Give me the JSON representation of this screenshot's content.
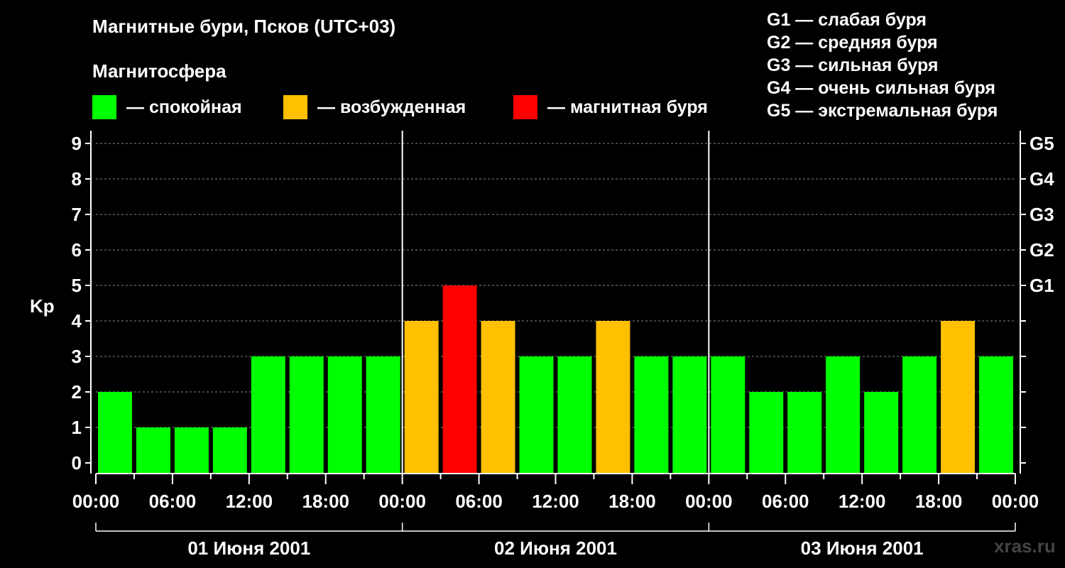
{
  "title": "Магнитные бури, Псков (UTC+03)",
  "subtitle": "Магнитосфера",
  "legend": [
    {
      "color": "#00ff00",
      "label": "— спокойная"
    },
    {
      "color": "#ffc000",
      "label": "— возбужденная"
    },
    {
      "color": "#ff0000",
      "label": "— магнитная буря"
    }
  ],
  "g_scale": [
    "G1 — слабая буря",
    "G2 — средняя буря",
    "G3 — сильная буря",
    "G4 — очень сильная буря",
    "G5 — экстремальная буря"
  ],
  "watermark": "xras.ru",
  "chart_data": {
    "type": "bar",
    "ylabel": "Kp",
    "ylim": [
      0,
      9
    ],
    "y_ticks": [
      "0",
      "1",
      "2",
      "3",
      "4",
      "5",
      "6",
      "7",
      "8",
      "9"
    ],
    "right_ticks": [
      {
        "value": 5,
        "label": "G1"
      },
      {
        "value": 6,
        "label": "G2"
      },
      {
        "value": 7,
        "label": "G3"
      },
      {
        "value": 8,
        "label": "G4"
      },
      {
        "value": 9,
        "label": "G5"
      }
    ],
    "x_tick_labels": [
      "00:00",
      "06:00",
      "12:00",
      "18:00",
      "00:00",
      "06:00",
      "12:00",
      "18:00",
      "00:00",
      "06:00",
      "12:00",
      "18:00",
      "00:00"
    ],
    "days": [
      "01 Июня 2001",
      "02 Июня 2001",
      "03 Июня 2001"
    ],
    "grid": "dashed horizontal",
    "values": [
      2,
      1,
      1,
      1,
      3,
      3,
      3,
      3,
      4,
      5,
      4,
      3,
      3,
      4,
      3,
      3,
      3,
      2,
      2,
      3,
      2,
      3,
      4,
      3
    ],
    "colors": [
      "#00ff00",
      "#00ff00",
      "#00ff00",
      "#00ff00",
      "#00ff00",
      "#00ff00",
      "#00ff00",
      "#00ff00",
      "#ffc000",
      "#ff0000",
      "#ffc000",
      "#00ff00",
      "#00ff00",
      "#ffc000",
      "#00ff00",
      "#00ff00",
      "#00ff00",
      "#00ff00",
      "#00ff00",
      "#00ff00",
      "#00ff00",
      "#00ff00",
      "#ffc000",
      "#00ff00"
    ]
  }
}
